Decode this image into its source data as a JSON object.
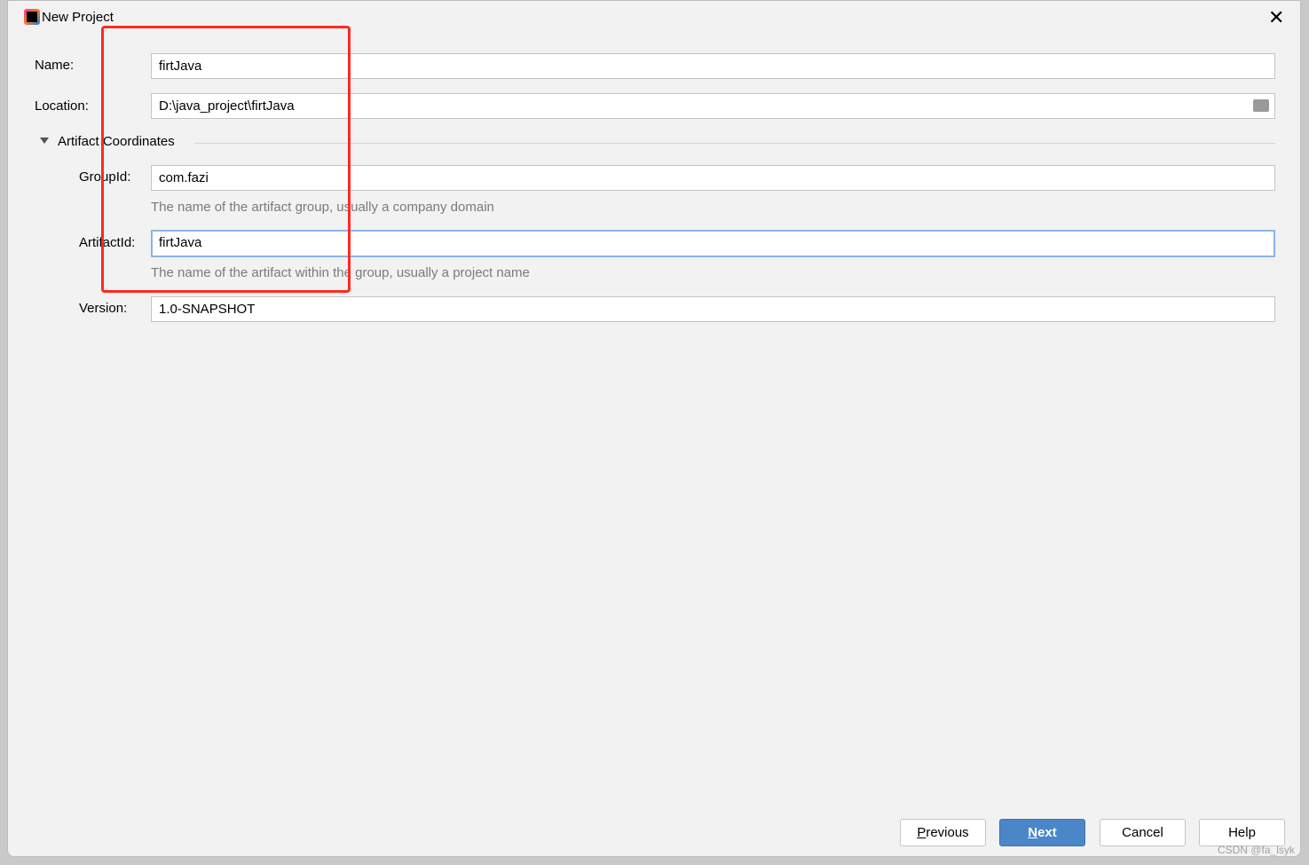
{
  "dialog": {
    "title": "New Project",
    "close_icon": "close-icon"
  },
  "form": {
    "name_label": "Name:",
    "name_value": "firtJava",
    "location_label": "Location:",
    "location_value": "D:\\java_project\\firtJava",
    "section_label": "Artifact Coordinates",
    "groupid_label": "GroupId:",
    "groupid_value": "com.fazi",
    "groupid_hint": "The name of the artifact group, usually a company domain",
    "artifactid_label": "ArtifactId:",
    "artifactid_value": "firtJava",
    "artifactid_hint": "The name of the artifact within the group, usually a project name",
    "version_label": "Version:",
    "version_value": "1.0-SNAPSHOT"
  },
  "buttons": {
    "previous_mnemonic": "P",
    "previous_rest": "revious",
    "next_mnemonic": "N",
    "next_rest": "ext",
    "cancel": "Cancel",
    "help": "Help"
  },
  "watermark": "CSDN @fa_lsyk",
  "colors": {
    "primary": "#4a86c8",
    "annotation": "#ff2a1f"
  }
}
